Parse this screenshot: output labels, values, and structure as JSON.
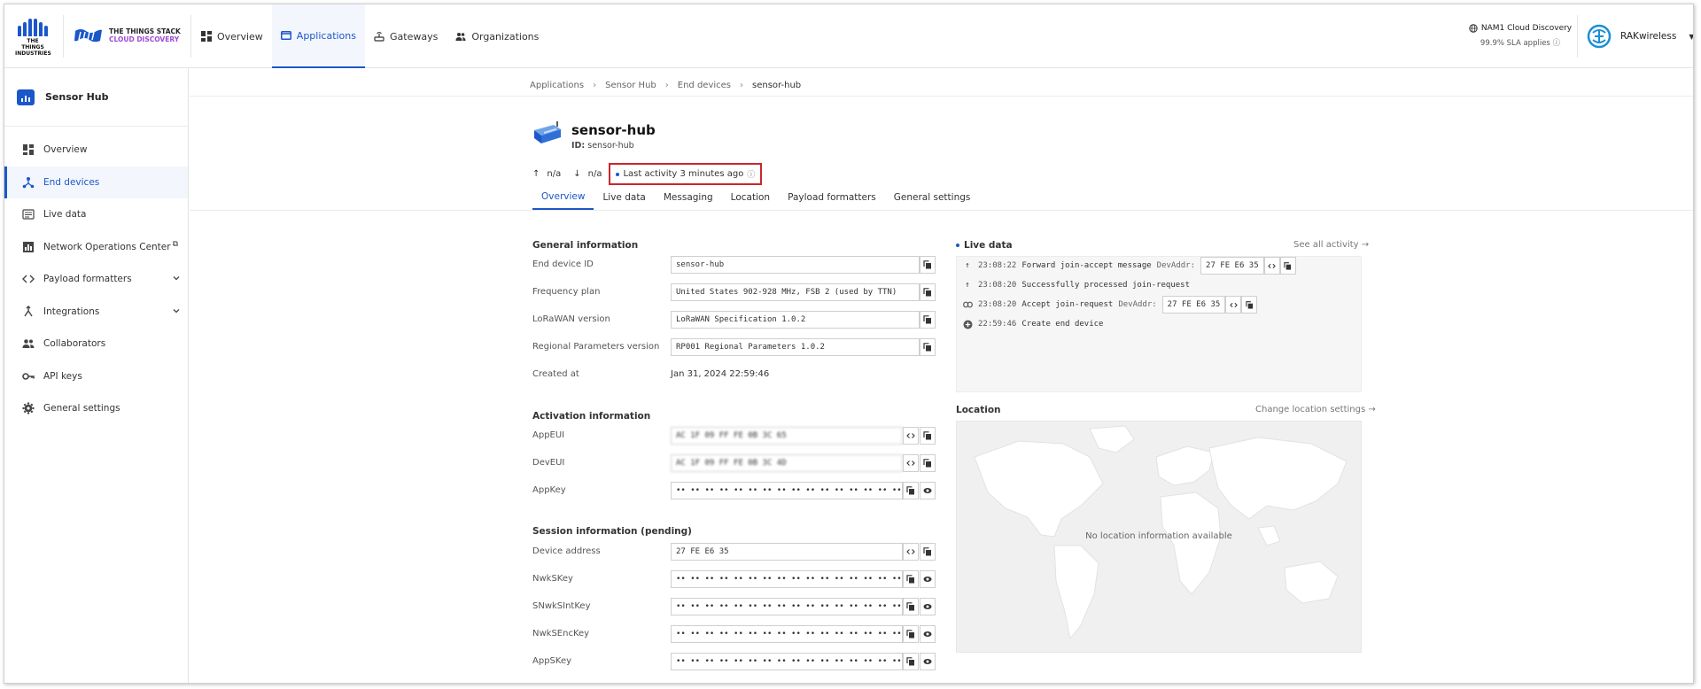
{
  "brand": {
    "tti_text": "THE THINGS INDUSTRIES",
    "product_line1": "THE THINGS STACK",
    "product_line2": "CLOUD DISCOVERY"
  },
  "topnav": [
    {
      "label": "Overview",
      "icon": "grid-icon"
    },
    {
      "label": "Applications",
      "icon": "window-icon",
      "active": true
    },
    {
      "label": "Gateways",
      "icon": "router-icon"
    },
    {
      "label": "Organizations",
      "icon": "people-icon"
    }
  ],
  "cluster": {
    "name": "NAM1 Cloud Discovery",
    "sla": "99.9% SLA applies"
  },
  "account": {
    "name": "RAKwireless"
  },
  "sidebar": {
    "app_name": "Sensor Hub",
    "items": [
      {
        "label": "Overview",
        "icon": "dashboard-icon"
      },
      {
        "label": "End devices",
        "icon": "device-hub-icon",
        "active": true
      },
      {
        "label": "Live data",
        "icon": "list-icon"
      },
      {
        "label": "Network Operations Center",
        "icon": "bar-chart-icon",
        "external": true
      },
      {
        "label": "Payload formatters",
        "icon": "code-icon",
        "expandable": true
      },
      {
        "label": "Integrations",
        "icon": "merge-icon",
        "expandable": true
      },
      {
        "label": "Collaborators",
        "icon": "people-icon"
      },
      {
        "label": "API keys",
        "icon": "key-icon"
      },
      {
        "label": "General settings",
        "icon": "gear-icon"
      }
    ]
  },
  "breadcrumbs": [
    "Applications",
    "Sensor Hub",
    "End devices",
    "sensor-hub"
  ],
  "device": {
    "name": "sensor-hub",
    "id_label": "ID:",
    "id": "sensor-hub",
    "uplink": "n/a",
    "downlink": "n/a",
    "last_activity": "Last activity 3 minutes ago"
  },
  "tabs": [
    "Overview",
    "Live data",
    "Messaging",
    "Location",
    "Payload formatters",
    "General settings"
  ],
  "general": {
    "title": "General information",
    "rows": [
      {
        "label": "End device ID",
        "value": "sensor-hub"
      },
      {
        "label": "Frequency plan",
        "value": "United States 902-928 MHz, FSB 2 (used by TTN)"
      },
      {
        "label": "LoRaWAN version",
        "value": "LoRaWAN Specification 1.0.2"
      },
      {
        "label": "Regional Parameters version",
        "value": "RP001 Regional Parameters 1.0.2"
      },
      {
        "label": "Created at",
        "value": "Jan 31, 2024 22:59:46"
      }
    ]
  },
  "activation": {
    "title": "Activation information",
    "rows": [
      {
        "label": "AppEUI",
        "value": "AC 1F 09 FF FE 0B 3C 65"
      },
      {
        "label": "DevEUI",
        "value": "AC 1F 09 FF FE 0B 3C 4D"
      },
      {
        "label": "AppKey",
        "value": "•• •• •• •• •• •• •• •• •• •• •• •• •• •• •• ••"
      }
    ]
  },
  "session": {
    "title": "Session information (pending)",
    "rows": [
      {
        "label": "Device address",
        "value": "27 FE E6 35"
      },
      {
        "label": "NwkSKey",
        "value": "•• •• •• •• •• •• •• •• •• •• •• •• •• •• •• ••"
      },
      {
        "label": "SNwkSIntKey",
        "value": "•• •• •• •• •• •• •• •• •• •• •• •• •• •• •• ••"
      },
      {
        "label": "NwkSEncKey",
        "value": "•• •• •• •• •• •• •• •• •• •• •• •• •• •• •• ••"
      },
      {
        "label": "AppSKey",
        "value": "•• •• •• •• •• •• •• •• •• •• •• •• •• •• •• ••"
      }
    ]
  },
  "live": {
    "title": "Live data",
    "link": "See all activity →",
    "events": [
      {
        "time": "23:08:22",
        "text": "Forward join-accept message",
        "key": "DevAddr:",
        "addr": "27 FE E6 35",
        "icon": "arrow-up-icon"
      },
      {
        "time": "23:08:20",
        "text": "Successfully processed join-request",
        "icon": "arrow-up-icon"
      },
      {
        "time": "23:08:20",
        "text": "Accept join-request",
        "key": "DevAddr:",
        "addr": "27 FE E6 35",
        "icon": "link-icon"
      },
      {
        "time": "22:59:46",
        "text": "Create end device",
        "icon": "add-circle-icon"
      }
    ]
  },
  "location": {
    "title": "Location",
    "link": "Change location settings →",
    "empty": "No location information available"
  },
  "colors": {
    "accent": "#1b57c9",
    "highlight": "#c9262c"
  }
}
